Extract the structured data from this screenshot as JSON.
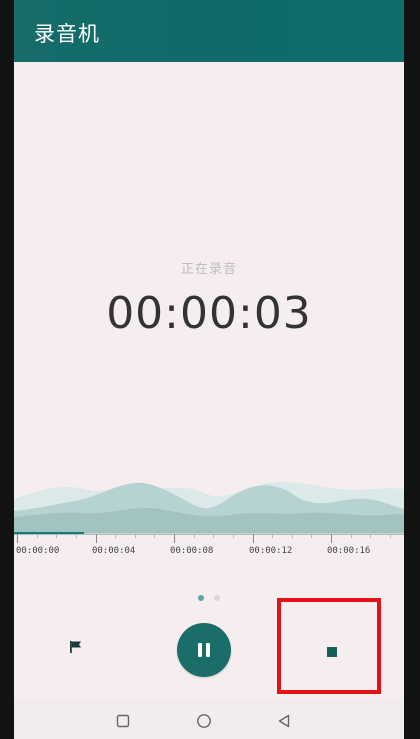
{
  "app": {
    "title": "录音机"
  },
  "recording": {
    "status": "正在录音",
    "elapsed": "00:00:03",
    "progress_fraction": 0.18
  },
  "timeline": {
    "labels": [
      "00:00:00",
      "00:00:04",
      "00:00:08",
      "00:00:12",
      "00:00:16"
    ]
  },
  "pager": {
    "active_page": 1,
    "page_count": 2
  },
  "controls": {
    "flag_icon": "flag-icon",
    "pause_icon": "pause-icon",
    "stop_icon": "stop-icon"
  },
  "navigation": {
    "recent_icon": "square-icon",
    "home_icon": "circle-icon",
    "back_icon": "triangle-back-icon"
  },
  "colors": {
    "accent": "#1b6d69",
    "highlight": "#e1121a",
    "wave_light": "#d8e8e8",
    "wave_dark": "#a9c8c6"
  }
}
